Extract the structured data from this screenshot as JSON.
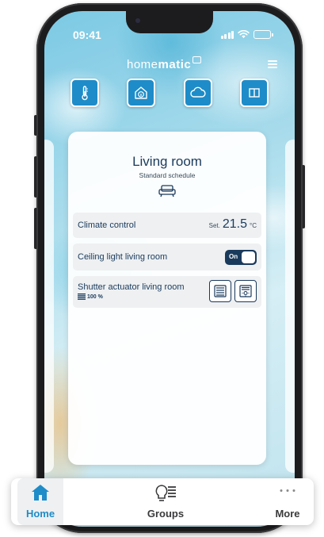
{
  "status_bar": {
    "time": "09:41"
  },
  "app": {
    "brand_light": "home",
    "brand_bold": "matic"
  },
  "quick_actions": [
    {
      "icon": "thermometer-icon"
    },
    {
      "icon": "house-info-icon"
    },
    {
      "icon": "cloud-icon"
    },
    {
      "icon": "window-icon"
    }
  ],
  "room": {
    "title": "Living room",
    "subtitle": "Standard schedule",
    "icon": "sofa-icon",
    "devices": {
      "climate": {
        "label": "Climate control",
        "set_prefix": "Set.",
        "value": "21.5",
        "unit": "°C"
      },
      "light": {
        "label": "Ceiling light living room",
        "state": "On"
      },
      "shutter": {
        "label": "Shutter actuator living room",
        "level": "100 %",
        "level_percent": 100
      }
    }
  },
  "tabs": [
    {
      "label": "Home",
      "icon": "house-icon",
      "active": true
    },
    {
      "label": "Groups",
      "icon": "bulb-list-icon",
      "active": false
    },
    {
      "label": "More",
      "icon": "more-dots-icon",
      "active": false
    }
  ],
  "colors": {
    "accent": "#1e8cc8",
    "dark_text": "#1a3a5c",
    "row_bg": "#eef0f2"
  }
}
